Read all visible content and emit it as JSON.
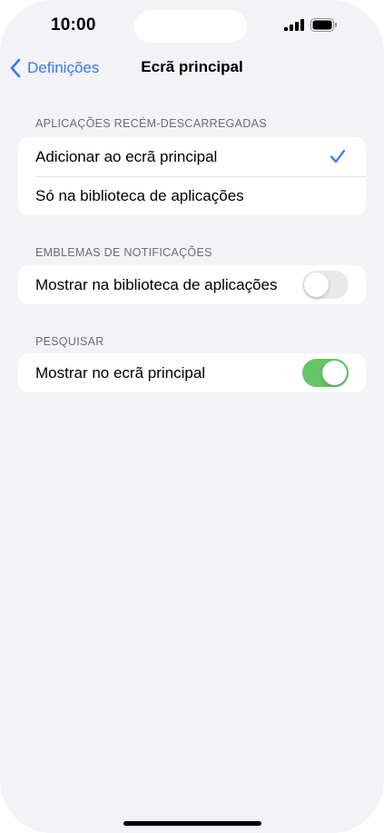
{
  "status_bar": {
    "time": "10:00",
    "icons": [
      "signal-icon",
      "battery-icon"
    ]
  },
  "nav": {
    "back_label": "Definições",
    "title": "Ecrã principal"
  },
  "sections": {
    "new_apps": {
      "header": "APLICAÇÕES RECÉM-DESCARREGADAS",
      "options": [
        {
          "label": "Adicionar ao ecrã principal",
          "selected": true
        },
        {
          "label": "Só na biblioteca de aplicações",
          "selected": false
        }
      ]
    },
    "badges": {
      "header": "EMBLEMAS DE NOTIFICAÇÕES",
      "row_label": "Mostrar na biblioteca de aplicações",
      "toggle_on": false
    },
    "search": {
      "header": "PESQUISAR",
      "row_label": "Mostrar no ecrã principal",
      "toggle_on": true
    }
  },
  "colors": {
    "accent": "#3478f6",
    "toggle_on": "#65c466",
    "toggle_off": "#e9e9eb",
    "background": "#f2f2f7"
  }
}
